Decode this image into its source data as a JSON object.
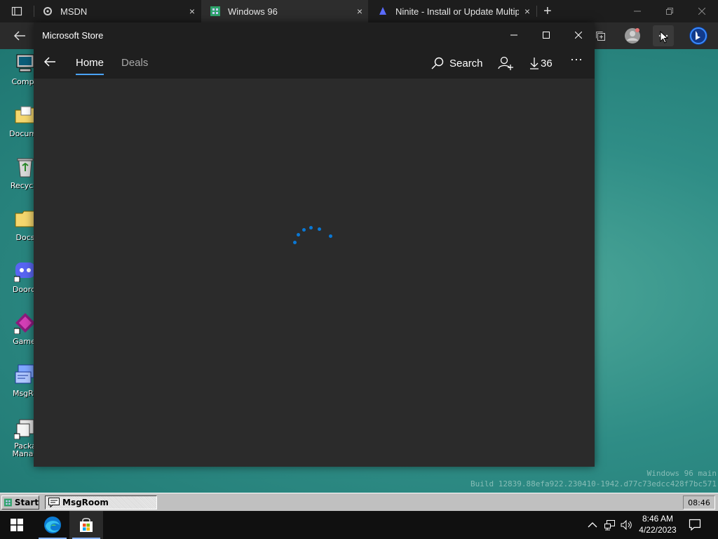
{
  "browser": {
    "tabs": [
      {
        "title": "MSDN",
        "active": false
      },
      {
        "title": "Windows 96",
        "active": true
      },
      {
        "title": "Ninite - Install or Update Multipl",
        "active": false
      }
    ],
    "new_tab_symbol": "+",
    "close_symbol": "×"
  },
  "store": {
    "title": "Microsoft Store",
    "nav": {
      "home": "Home",
      "deals": "Deals"
    },
    "search_label": "Search",
    "downloads_count": "36",
    "more_symbol": "···",
    "loading": true,
    "accent_color": "#0a78d4"
  },
  "desktop": {
    "icons": [
      {
        "label": "Compu",
        "icon": "computer-icon",
        "selected": false
      },
      {
        "label": "Docume",
        "icon": "documents-folder-icon",
        "selected": false
      },
      {
        "label": "Recycle",
        "icon": "recycle-bin-icon",
        "selected": false
      },
      {
        "label": "Docs",
        "icon": "folder-icon",
        "selected": false
      },
      {
        "label": "Doordi",
        "icon": "discord-icon",
        "selected": false
      },
      {
        "label": "Gamei",
        "icon": "game-icon",
        "selected": false
      },
      {
        "label": "MsgRo",
        "icon": "msgroom-icon",
        "selected": true
      },
      {
        "label": "Packa Manag",
        "icon": "package-manager-icon",
        "selected": false
      }
    ],
    "watermark_line1": "Windows 96 main",
    "watermark_line2": "Build 12839.88efa922.230410-1942.d77c73edcc428f7bc571"
  },
  "w96_taskbar": {
    "start_label": "Start",
    "task_label": "MsgRoom",
    "clock": "08:46"
  },
  "taskbar": {
    "time": "8:46 AM",
    "date": "4/22/2023"
  }
}
